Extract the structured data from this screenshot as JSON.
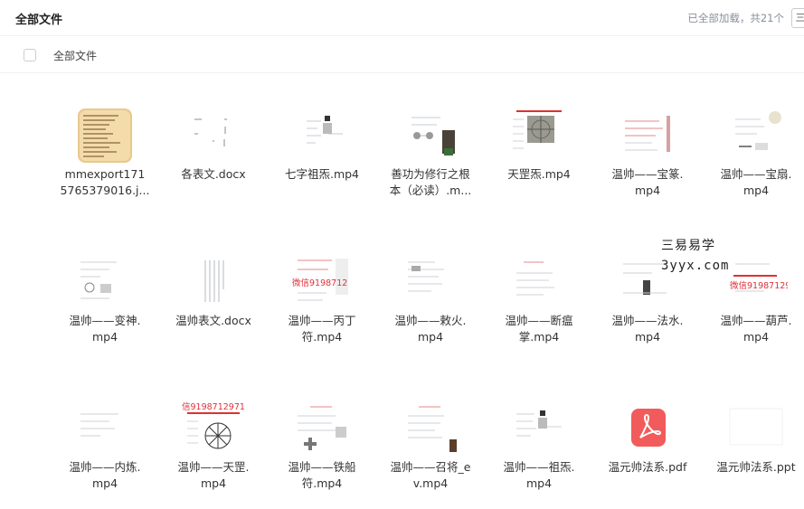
{
  "header": {
    "title": "全部文件",
    "status": "已全部加载，共21个",
    "button_glyph": "三"
  },
  "breadcrumb": {
    "label": "全部文件"
  },
  "watermark": {
    "text": "三易易学\n3yyx.com"
  },
  "thumb_text": {
    "wechat_1": "微信9198712",
    "wechat_2": "微信9198712",
    "wechat_3": "微信919871297",
    "wechat_4": "信9198712971"
  },
  "files": [
    {
      "name": "mmexport171\n5765379016.j...",
      "type": "image"
    },
    {
      "name": "各表文.docx",
      "type": "doc"
    },
    {
      "name": "七字祖炁.mp4",
      "type": "video"
    },
    {
      "name": "善功为修行之根\n本（必读）.m...",
      "type": "video"
    },
    {
      "name": "天罡炁.mp4",
      "type": "video"
    },
    {
      "name": "温帅——宝篆.\nmp4",
      "type": "video"
    },
    {
      "name": "温帅——宝扇.\nmp4",
      "type": "video"
    },
    {
      "name": "温帅——变神.\nmp4",
      "type": "video"
    },
    {
      "name": "温帅表文.docx",
      "type": "doc"
    },
    {
      "name": "温帅——丙丁\n符.mp4",
      "type": "video"
    },
    {
      "name": "温帅——敕火.\nmp4",
      "type": "video"
    },
    {
      "name": "温帅——断瘟\n掌.mp4",
      "type": "video"
    },
    {
      "name": "温帅——法水.\nmp4",
      "type": "video"
    },
    {
      "name": "温帅——葫芦.\nmp4",
      "type": "video"
    },
    {
      "name": "温帅——内炼.\nmp4",
      "type": "video"
    },
    {
      "name": "温帅——天罡.\nmp4",
      "type": "video"
    },
    {
      "name": "温帅——铁船\n符.mp4",
      "type": "video"
    },
    {
      "name": "温帅——召将_e\nv.mp4",
      "type": "video"
    },
    {
      "name": "温帅——祖炁.\nmp4",
      "type": "video"
    },
    {
      "name": "温元帅法系.pdf",
      "type": "pdf"
    },
    {
      "name": "温元帅法系.ppt",
      "type": "ppt"
    }
  ]
}
